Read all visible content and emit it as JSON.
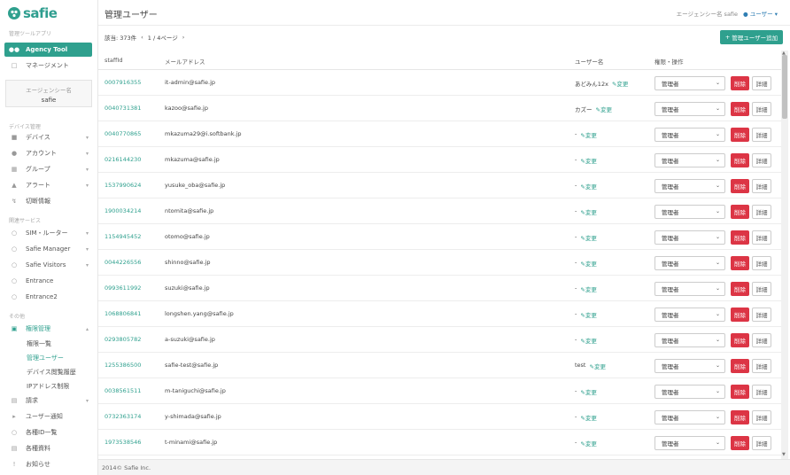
{
  "brand": {
    "name": "safie"
  },
  "sidebar": {
    "section_tool": "管理ツールアプリ",
    "agency_tool": "Agency Tool",
    "management": "マネージメント",
    "agency_box": {
      "label": "エージェンシー名",
      "value": "safie"
    },
    "section_device": "デバイス管理",
    "device_items": [
      {
        "label": "デバイス",
        "icon": "camera-icon"
      },
      {
        "label": "アカウント",
        "icon": "user-icon"
      },
      {
        "label": "グループ",
        "icon": "grid-icon"
      },
      {
        "label": "アラート",
        "icon": "bell-icon"
      },
      {
        "label": "切断情報",
        "icon": "bolt-icon"
      }
    ],
    "section_related": "関連サービス",
    "related_items": [
      {
        "label": "SIM・ルーター"
      },
      {
        "label": "Safie Manager"
      },
      {
        "label": "Safie Visitors"
      },
      {
        "label": "Entrance"
      },
      {
        "label": "Entrance2"
      }
    ],
    "section_other": "その他",
    "permission": "権限管理",
    "permission_sub": [
      "権限一覧",
      "管理ユーザー",
      "デバイス閲覧履歴",
      "IPアドレス制限"
    ],
    "other_items": [
      {
        "label": "請求",
        "icon": "billing-icon"
      },
      {
        "label": "ユーザー通知",
        "icon": "megaphone-icon"
      },
      {
        "label": "各種ID一覧",
        "icon": "circle-icon"
      },
      {
        "label": "各種資料",
        "icon": "document-icon"
      },
      {
        "label": "お知らせ",
        "icon": "exclamation-icon"
      }
    ]
  },
  "header": {
    "title": "管理ユーザー",
    "agency_label": "エージェンシー名 safie",
    "user_label": "ユーザー"
  },
  "toolbar": {
    "count": "該当: 373件",
    "prev": "‹",
    "page": "1 / 4ページ",
    "next": "›",
    "add_button": "管理ユーザー追加"
  },
  "table": {
    "headers": {
      "staff_id": "staffId",
      "email": "メールアドレス",
      "user_name": "ユーザー名",
      "action": "権限・操作"
    },
    "change_label": "変更",
    "role_label": "管理者",
    "delete_label": "削除",
    "detail_label": "詳細",
    "rows": [
      {
        "id": "0007916355",
        "email": "it-admin@safie.jp",
        "name": "あどみん12x"
      },
      {
        "id": "0040731381",
        "email": "kazoo@safie.jp",
        "name": "カズー"
      },
      {
        "id": "0040770865",
        "email": "mkazuma29@i.softbank.jp",
        "name": "-"
      },
      {
        "id": "0216144230",
        "email": "mkazuma@safie.jp",
        "name": "-"
      },
      {
        "id": "1537990624",
        "email": "yusuke_oba@safie.jp",
        "name": "-"
      },
      {
        "id": "1900034214",
        "email": "ntomita@safie.jp",
        "name": "-"
      },
      {
        "id": "1154945452",
        "email": "otomo@safie.jp",
        "name": "-"
      },
      {
        "id": "0044226556",
        "email": "shinno@safie.jp",
        "name": "-"
      },
      {
        "id": "0993611992",
        "email": "suzuki@safie.jp",
        "name": "-"
      },
      {
        "id": "1068806841",
        "email": "longshen.yang@safie.jp",
        "name": "-"
      },
      {
        "id": "0293805782",
        "email": "a-suzuki@safie.jp",
        "name": "-"
      },
      {
        "id": "1255386500",
        "email": "safie-test@safie.jp",
        "name": "test"
      },
      {
        "id": "0038561511",
        "email": "m-taniguchi@safie.jp",
        "name": "-"
      },
      {
        "id": "0732363174",
        "email": "y-shimada@safie.jp",
        "name": "-"
      },
      {
        "id": "1973538546",
        "email": "t-minami@safie.jp",
        "name": "-"
      }
    ]
  },
  "footer": {
    "copyright": "2014© Safie Inc."
  },
  "colors": {
    "accent": "#2fa08e",
    "danger": "#dc3545",
    "link": "#2f7eb3"
  }
}
